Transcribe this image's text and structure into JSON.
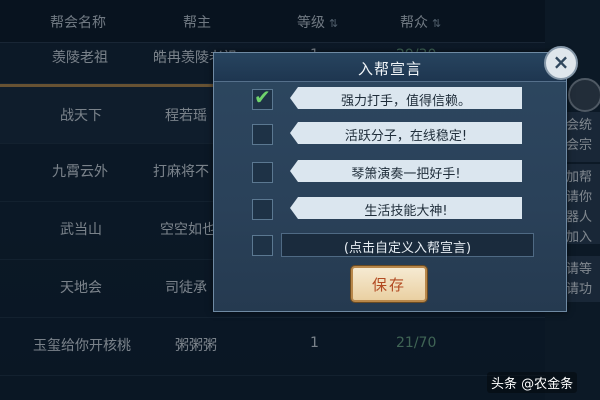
{
  "table": {
    "headers": {
      "name": "帮会名称",
      "leader": "帮主",
      "level": "等级",
      "members": "帮众",
      "sort_glyph": "⇅"
    },
    "rows": [
      {
        "name": "羡陵老祖",
        "leader": "皓冉羡陵老祖",
        "level": "1",
        "members": "29/30"
      },
      {
        "name": "战天下",
        "leader": "程若瑶",
        "level": "",
        "members": ""
      },
      {
        "name": "九霄云外",
        "leader": "打麻将不",
        "level": "",
        "members": ""
      },
      {
        "name": "武当山",
        "leader": "空空如也",
        "level": "",
        "members": ""
      },
      {
        "name": "天地会",
        "leader": "司徒承",
        "level": "",
        "members": ""
      },
      {
        "name": "玉玺给你开核桃",
        "leader": "粥粥粥",
        "level": "1",
        "members": "21/70"
      }
    ]
  },
  "side_panel": {
    "lines_top": [
      "会统",
      "会宗"
    ],
    "lines_mid": [
      "加帮",
      "请你",
      "器人",
      "加入"
    ],
    "lines_bot": [
      "请等",
      "请功"
    ]
  },
  "modal": {
    "title": "入帮宣言",
    "close_label": "×",
    "options": [
      {
        "text": "强力打手，值得信赖。",
        "checked": true
      },
      {
        "text": "活跃分子，在线稳定!",
        "checked": false
      },
      {
        "text": "琴箫演奏一把好手!",
        "checked": false
      },
      {
        "text": "生活技能大神!",
        "checked": false
      }
    ],
    "custom_text": "(点击自定义入帮宣言)",
    "save_label": "保存"
  },
  "watermark": "头条 @农金条"
}
